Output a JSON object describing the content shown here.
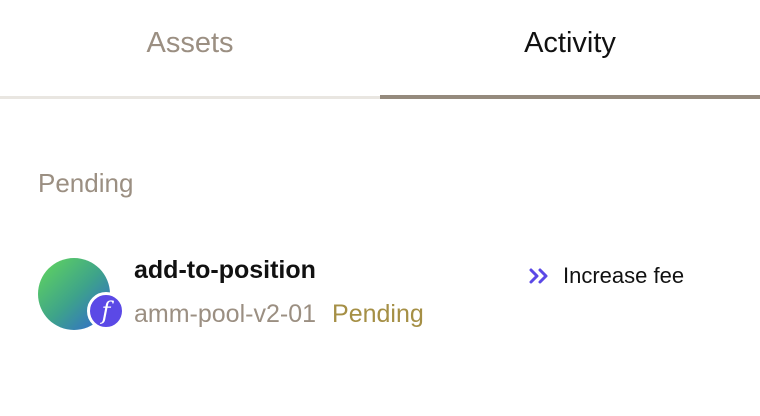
{
  "tabs": [
    {
      "label": "Assets",
      "active": false
    },
    {
      "label": "Activity",
      "active": true
    }
  ],
  "pending": {
    "title": "Pending",
    "item": {
      "icon": "position-token-icon",
      "badge_icon": "function-icon",
      "name": "add-to-position",
      "pool": "amm-pool-v2-01",
      "status": "Pending",
      "action_label": "Increase fee"
    }
  },
  "colors": {
    "accent": "#5b49e6",
    "muted_text": "#9b8f82",
    "pending_status": "#a58f45",
    "active_tab_underline": "#958a7d"
  }
}
